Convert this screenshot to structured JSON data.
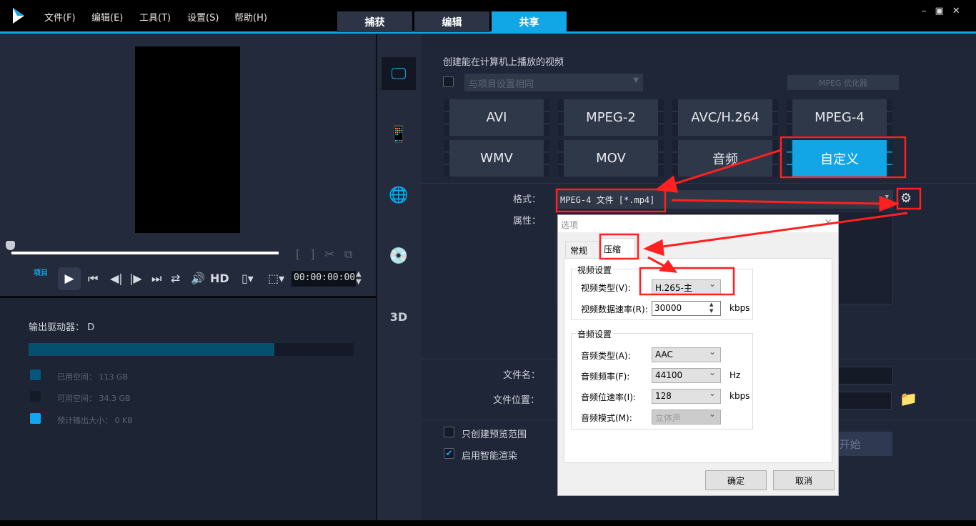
{
  "menu": [
    "文件(F)",
    "编辑(E)",
    "工具(T)",
    "设置(S)",
    "帮助(H)"
  ],
  "tabs": [
    "捕获",
    "编辑",
    "共享"
  ],
  "active_tab": "共享",
  "player": {
    "project_label": "项目",
    "hd": "HD",
    "timecode": "00:00:00:00"
  },
  "drive": {
    "label": "输出驱动器：",
    "value": "D",
    "used_fraction": 0.755,
    "legend": [
      {
        "label": "已用空间：",
        "value": "113 GB",
        "color": "#05567e"
      },
      {
        "label": "可用空间：",
        "value": "34.3 GB",
        "color": "#141a28"
      },
      {
        "label": "预计输出大小：",
        "value": "0 KB",
        "color": "#12a6f0"
      }
    ]
  },
  "share": {
    "heading": "创建能在计算机上播放的视频",
    "same_as_project": "与项目设置相同",
    "mpeg_optimizer": "MPEG 优化器",
    "formats": [
      "AVI",
      "MPEG-2",
      "AVC/H.264",
      "MPEG-4",
      "WMV",
      "MOV",
      "音频",
      "自定义"
    ],
    "active_format": "自定义",
    "format_label": "格式：",
    "format_value": "MPEG-4 文件 [*.mp4]",
    "props_label": "属性：",
    "filename_label": "文件名：",
    "location_label": "文件位置：",
    "preview_only": "只创建预览范围",
    "smart_render": "启用智能渲染",
    "smart_render_checked": true,
    "start": "开始"
  },
  "dialog": {
    "title": "选项",
    "tabs": [
      "常规",
      "压缩"
    ],
    "active_tab": "压缩",
    "video_group": "视频设置",
    "video_type_label": "视频类型(V):",
    "video_type": "H.265-主",
    "video_rate_label": "视频数据速率(R):",
    "video_rate": "30000",
    "kbps": "kbps",
    "audio_group": "音频设置",
    "audio_type_label": "音频类型(A):",
    "audio_type": "AAC",
    "audio_freq_label": "音频频率(F):",
    "audio_freq": "44100",
    "hz": "Hz",
    "audio_bitrate_label": "音频位速率(I):",
    "audio_bitrate": "128",
    "audio_mode_label": "音频模式(M):",
    "audio_mode": "立体声",
    "ok": "确定",
    "cancel": "取消"
  },
  "colors": {
    "accent": "#12a6e6",
    "annotation": "#ff2020"
  }
}
